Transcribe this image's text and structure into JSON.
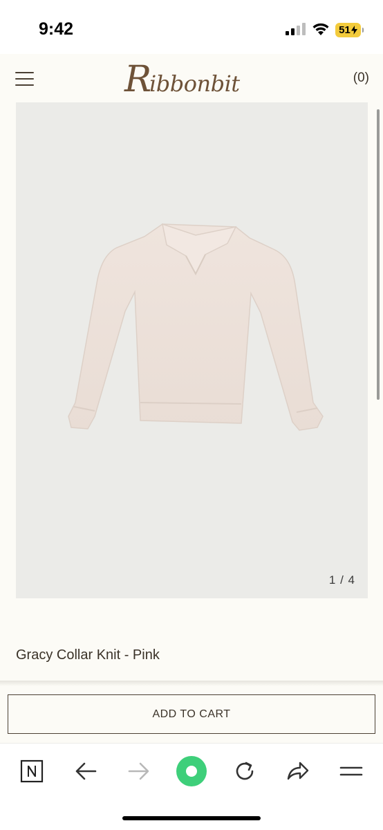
{
  "status_bar": {
    "time": "9:42",
    "battery": "51"
  },
  "header": {
    "logo_text": "Ribbonbit",
    "cart_count": "(0)"
  },
  "product": {
    "image_counter": "1 / 4",
    "name": "Gracy Collar Knit - Pink",
    "add_to_cart_label": "ADD TO CART"
  },
  "toolbar": {
    "icons": [
      "naver-n-icon",
      "back-arrow-icon",
      "forward-arrow-icon",
      "green-dot-icon",
      "refresh-icon",
      "share-icon",
      "menu-icon"
    ]
  },
  "colors": {
    "page_bg": "#fcfbf6",
    "image_bg": "#ebebe8",
    "sweater": "#ece0d9",
    "logo": "#6e5238",
    "accent_green": "#3ecf7a",
    "battery": "#f3cb3c"
  }
}
